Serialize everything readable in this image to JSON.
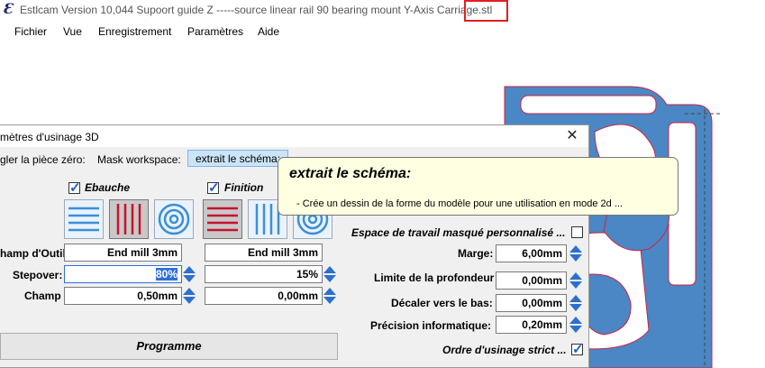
{
  "window": {
    "title": "Estlcam Version 10,044 Supoort guide Z -----source  linear rail 90 bearing mount Y-Axis Carriage.stl",
    "icon": "estlcam-logo-icon"
  },
  "menu": [
    "Fichier",
    "Vue",
    "Enregistrement",
    "Paramètres",
    "Aide"
  ],
  "colors": {
    "model_fill": "#4a87c4",
    "model_edge": "#cc2244",
    "highlight_box": "#e02020",
    "tooltip_bg": "#ffffe1",
    "selection": "#2f6fd8",
    "spinner": "#2c6fcf",
    "stripe_red": "#c8102e",
    "stripe_blue": "#3a8fd8"
  },
  "dialog": {
    "title": "mètres d'usinage 3D",
    "toolbar": {
      "set_zero_label": "gler la pièce zéro:",
      "mask_workspace_label": "Mask workspace:",
      "extract_button": "extrait le schéma:"
    },
    "roughing": {
      "label": "Ebauche",
      "checked": true
    },
    "finishing": {
      "label": "Finition",
      "checked": true
    },
    "rows": {
      "tool_label": "hamp d'Outil",
      "stepover_label": "Stepover:",
      "depth_label": "Champ"
    },
    "roughing_values": {
      "tool": "End mill 3mm",
      "stepover": "80%",
      "depth": "0,50mm"
    },
    "finishing_values": {
      "tool": "End mill 3mm",
      "stepover": "15%",
      "depth": "0,00mm"
    },
    "right": {
      "custom_workspace_label": "Espace de travail masqué personnalisé ...",
      "custom_workspace_checked": false,
      "margin_label": "Marge:",
      "margin_value": "6,00mm",
      "depth_limit_label": "Limite de la profondeur",
      "depth_limit_value": "0,00mm",
      "shift_down_label": "Décaler vers le bas:",
      "shift_down_value": "0,00mm",
      "precision_label": "Précision informatique:",
      "precision_value": "0,20mm",
      "strict_order_label": "Ordre d'usinage strict ...",
      "strict_order_checked": true
    },
    "program_button": "Programme"
  },
  "tooltip": {
    "title": "extrait  le schéma:",
    "body": "- Crée un dessin de la forme du modèle pour une utilisation en mode 2d ..."
  }
}
